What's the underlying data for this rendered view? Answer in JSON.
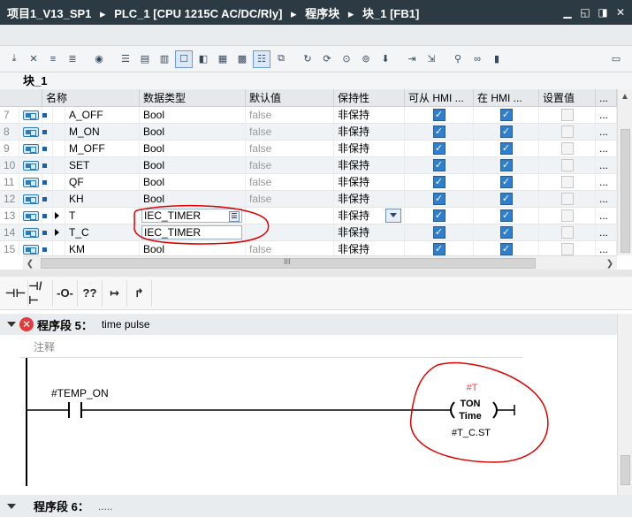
{
  "titlebar": {
    "crumbs": [
      "项目1_V13_SP1",
      "▸",
      "PLC_1 [CPU 1215C AC/DC/Rly]",
      "▸",
      "程序块",
      "▸",
      "块_1 [FB1]"
    ],
    "buttons": [
      "▁",
      "◱",
      "◨",
      "✕"
    ]
  },
  "block_title": "块_1",
  "table": {
    "headers": [
      "名称",
      "数据类型",
      "默认值",
      "保持性",
      "可从 HMI ...",
      "在 HMI ...",
      "设置值",
      "..."
    ],
    "rows": [
      {
        "idx": "7",
        "name": "A_OFF",
        "type": "Bool",
        "default": "false",
        "retain": "非保持",
        "hmi1": true,
        "hmi2": true,
        "set": false,
        "more": "..."
      },
      {
        "idx": "8",
        "name": "M_ON",
        "type": "Bool",
        "default": "false",
        "retain": "非保持",
        "hmi1": true,
        "hmi2": true,
        "set": false,
        "more": "..."
      },
      {
        "idx": "9",
        "name": "M_OFF",
        "type": "Bool",
        "default": "false",
        "retain": "非保持",
        "hmi1": true,
        "hmi2": true,
        "set": false,
        "more": "..."
      },
      {
        "idx": "10",
        "name": "SET",
        "type": "Bool",
        "default": "false",
        "retain": "非保持",
        "hmi1": true,
        "hmi2": true,
        "set": false,
        "more": "..."
      },
      {
        "idx": "11",
        "name": "QF",
        "type": "Bool",
        "default": "false",
        "retain": "非保持",
        "hmi1": true,
        "hmi2": true,
        "set": false,
        "more": "..."
      },
      {
        "idx": "12",
        "name": "KH",
        "type": "Bool",
        "default": "false",
        "retain": "非保持",
        "hmi1": true,
        "hmi2": true,
        "set": false,
        "more": "..."
      },
      {
        "idx": "13",
        "name": "T",
        "type": "IEC_TIMER",
        "default": "",
        "retain": "非保持",
        "hmi1": true,
        "hmi2": true,
        "set": false,
        "more": "..."
      },
      {
        "idx": "14",
        "name": "T_C",
        "type": "IEC_TIMER",
        "default": "",
        "retain": "非保持",
        "hmi1": true,
        "hmi2": true,
        "set": false,
        "more": "..."
      },
      {
        "idx": "15",
        "name": "KM",
        "type": "Bool",
        "default": "false",
        "retain": "非保持",
        "hmi1": true,
        "hmi2": true,
        "set": false,
        "more": "..."
      }
    ],
    "hscroll_label": "III"
  },
  "ladder_toolbar": [
    "⊣⊢",
    "⊣/⊢",
    "-O-",
    "??",
    "↦",
    "↱"
  ],
  "segment5": {
    "title": "程序段 5：",
    "description": "time pulse",
    "comment": "注释",
    "contact_label": "#TEMP_ON",
    "instance": "#T",
    "coil_name": "TON",
    "coil_type": "Time",
    "coil_operand": "#T_C.ST"
  },
  "segment6": {
    "title": "程序段 6：",
    "description": "....."
  },
  "colors": {
    "title_bg": "#2b3a43",
    "annotation": "#e00000",
    "instance_label": "#e0454c",
    "checkbox": "#2f7fcf"
  }
}
